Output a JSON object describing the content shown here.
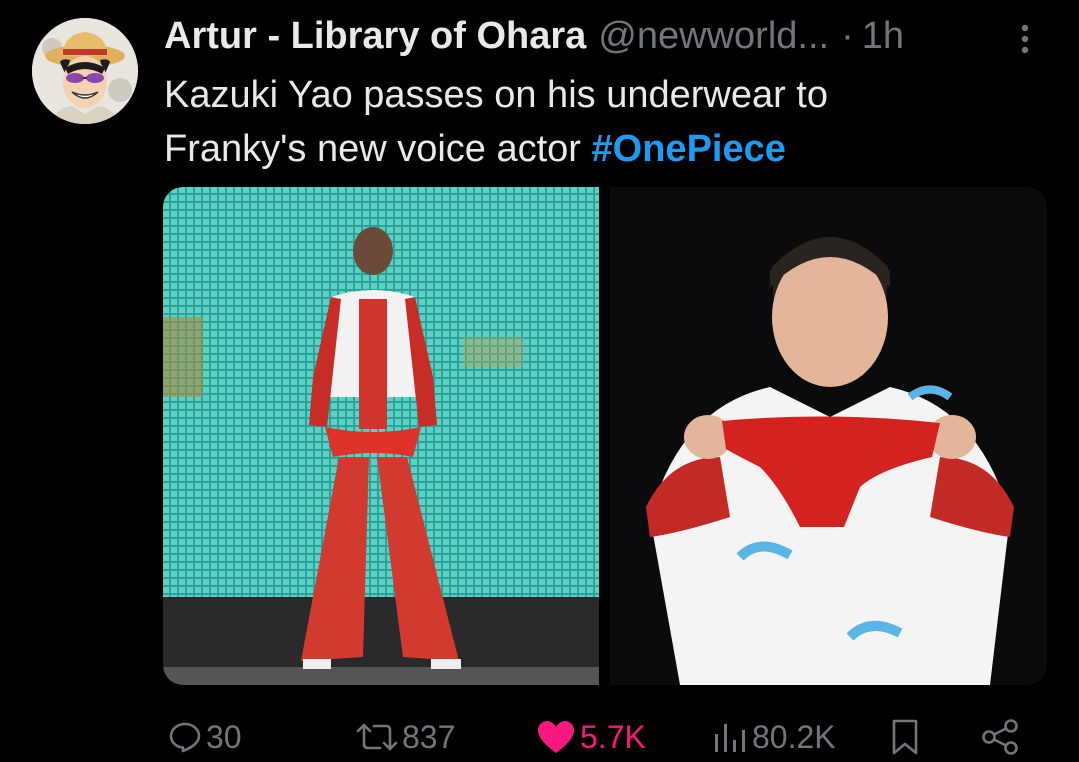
{
  "post": {
    "author_name": "Artur - Library of Ohara",
    "handle": "@newworld...",
    "separator": "·",
    "time_ago": "1h",
    "text_line1": "Kazuki Yao passes on his underwear to",
    "text_line2": "Franky's new voice actor ",
    "hashtag": "#OnePiece"
  },
  "actions": {
    "replies": "30",
    "reposts": "837",
    "likes": "5.7K",
    "views": "80.2K"
  },
  "icons": {
    "reply": "speech-bubble-icon",
    "repost": "repost-arrows-icon",
    "like": "heart-icon",
    "views": "bar-chart-icon",
    "bookmark": "bookmark-icon",
    "share": "share-icon",
    "more": "vertical-dots-icon"
  },
  "colors": {
    "background": "#000000",
    "text": "#e7e9ea",
    "secondary": "#71767b",
    "link": "#1d9bf0",
    "like": "#f91880"
  }
}
